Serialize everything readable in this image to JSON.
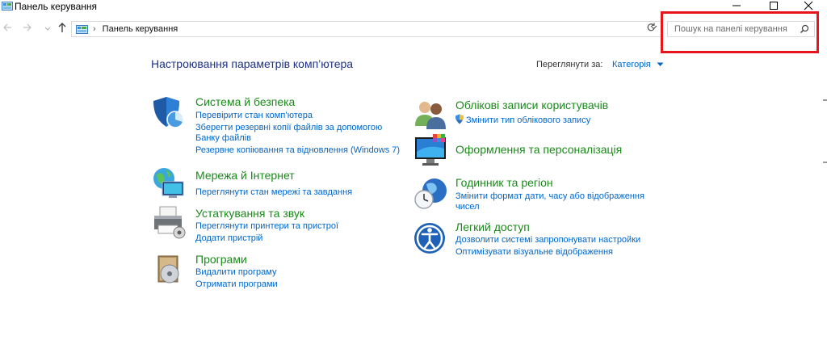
{
  "window": {
    "title": "Панель керування"
  },
  "address": {
    "path": "Панель керування"
  },
  "search": {
    "placeholder": "Пошук на панелі керування"
  },
  "main": {
    "heading": "Настроювання параметрів комп’ютера",
    "view_by_label": "Переглянути за:",
    "view_by_value": "Категорія"
  },
  "categories": {
    "security": {
      "title": "Система й безпека",
      "links": [
        "Перевірити стан комп’ютера",
        "Зберегти резервні копії файлів за допомогою",
        "Банку файлів",
        "Резервне копіювання та відновлення (Windows 7)"
      ]
    },
    "network": {
      "title": "Мережа й Інтернет",
      "links": [
        "Переглянути стан мережі та завдання"
      ]
    },
    "hardware": {
      "title": "Устаткування та звук",
      "links": [
        "Переглянути принтери та пристрої",
        "Додати пристрій"
      ]
    },
    "programs": {
      "title": "Програми",
      "links": [
        "Видалити програму",
        "Отримати програми"
      ]
    },
    "accounts": {
      "title": "Облікові записи користувачів",
      "links": [
        "Змінити тип облікового запису"
      ]
    },
    "appearance": {
      "title": "Оформлення та персоналізація",
      "links": []
    },
    "clock": {
      "title": "Годинник та регіон",
      "links": [
        "Змінити формат дати, часу або відображення",
        "чисел"
      ]
    },
    "ease": {
      "title": "Легкий доступ",
      "links": [
        "Дозволити системі запропонувати настройки",
        "Оптимізувати візуальне відображення"
      ]
    }
  },
  "colors": {
    "category_title": "#1a8a1a",
    "link": "#0066cc",
    "heading": "#1e3287",
    "highlight": "#e8141c"
  },
  "icons": {
    "window": "control-panel-icon",
    "security": "shield-icon",
    "network": "network-globe-icon",
    "hardware": "printer-icon",
    "programs": "programs-disc-icon",
    "accounts": "users-icon",
    "appearance": "monitor-palette-icon",
    "clock": "clock-globe-icon",
    "ease": "accessibility-icon"
  }
}
